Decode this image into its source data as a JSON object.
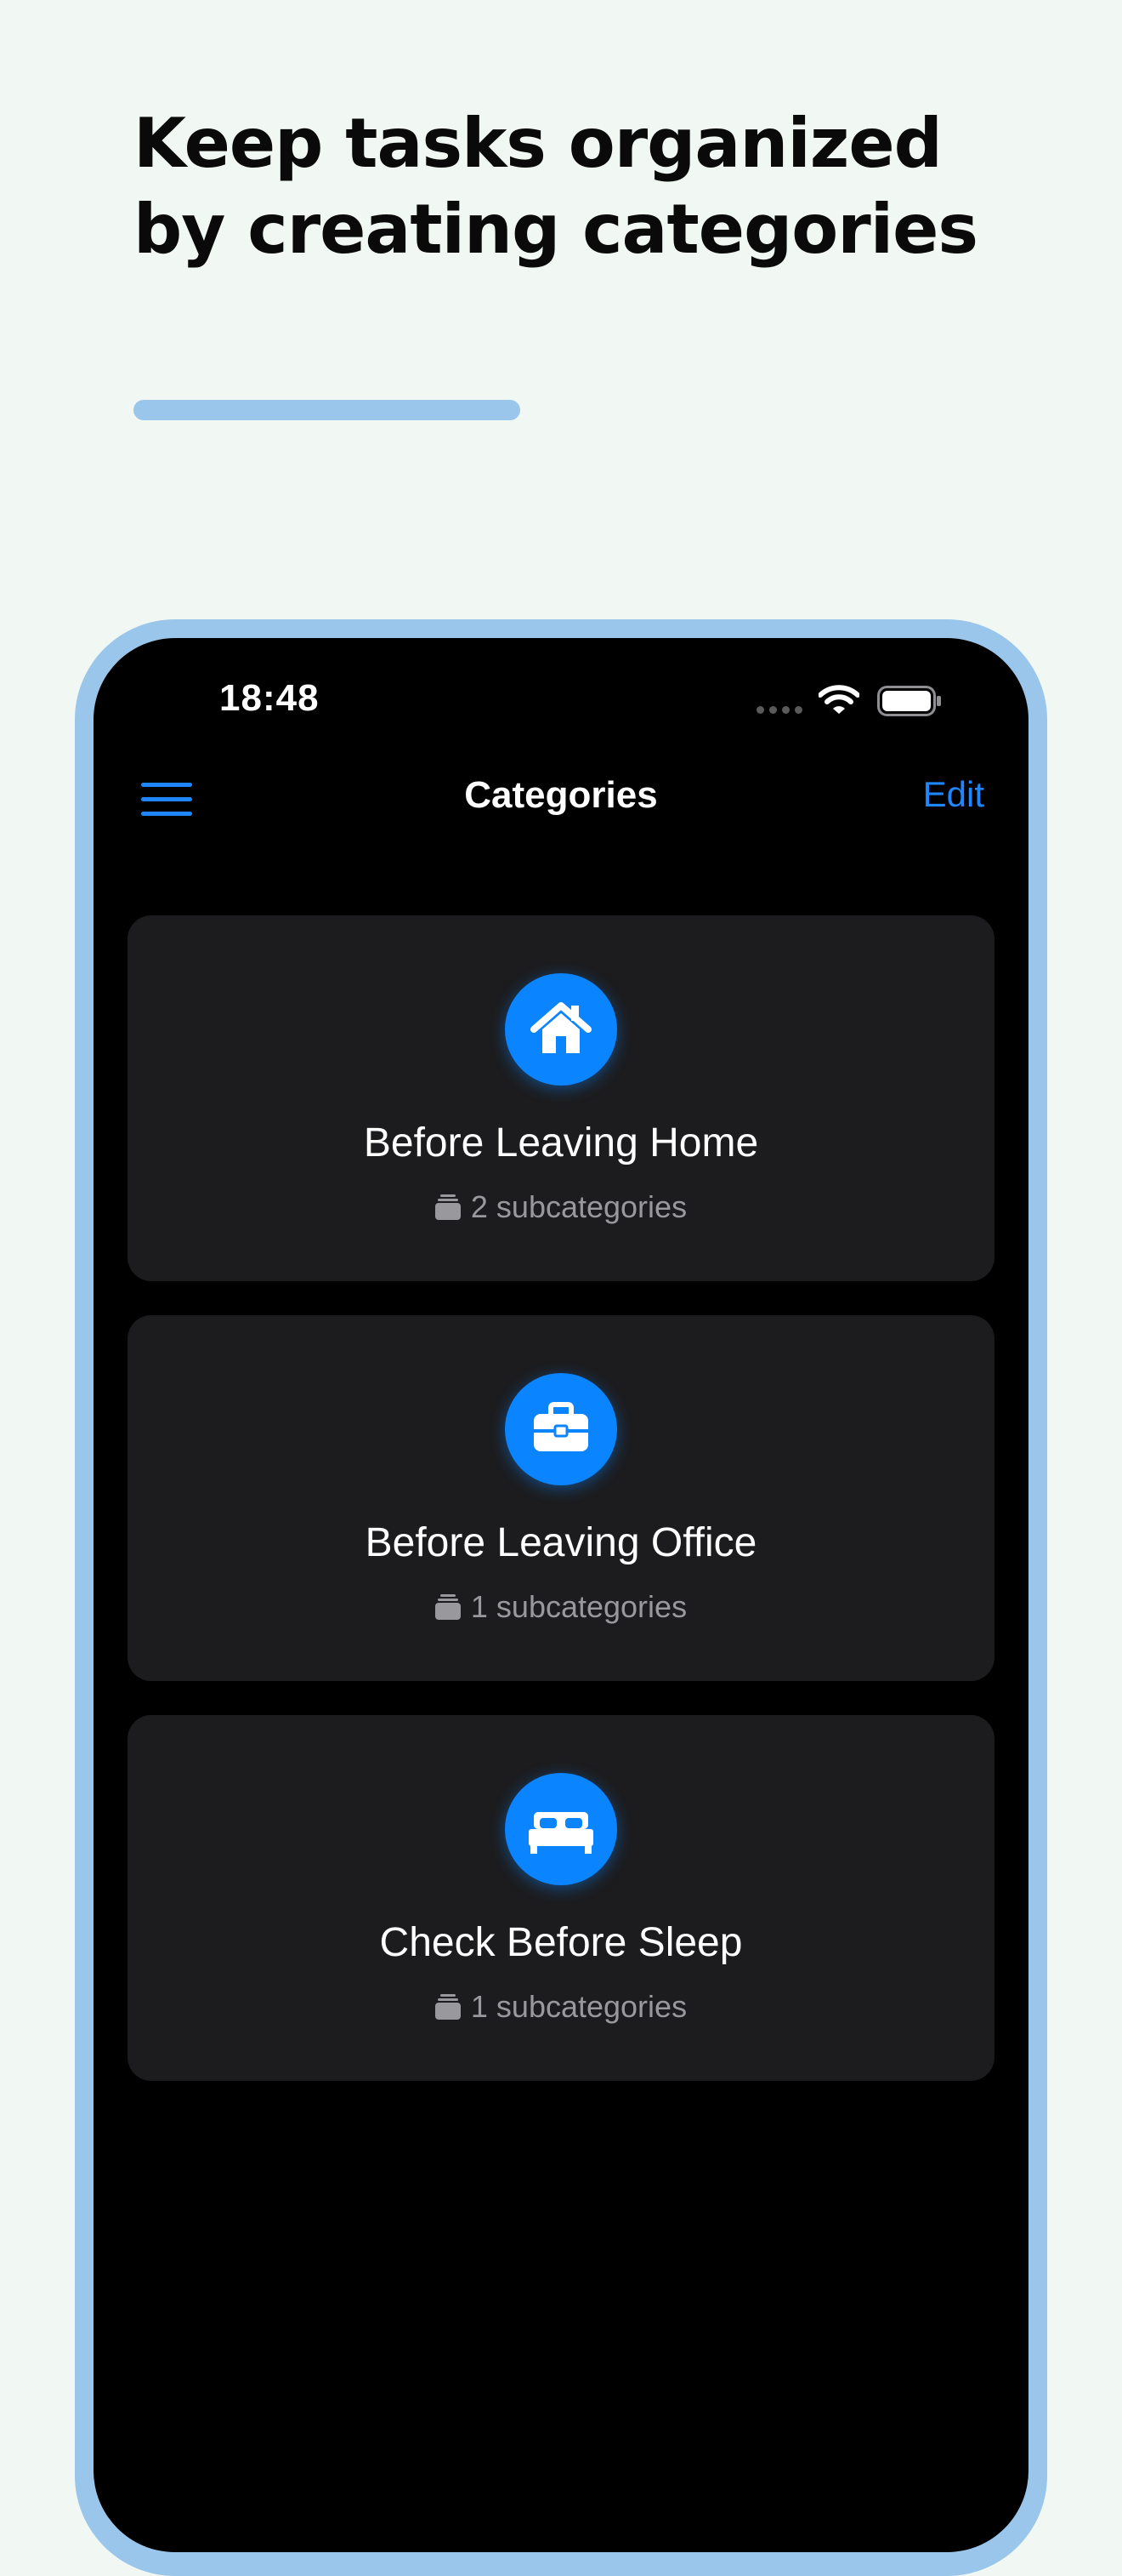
{
  "promo": {
    "headline_line1": "Keep tasks organized",
    "headline_line2": "by creating categories"
  },
  "status_bar": {
    "time": "18:48",
    "icons": [
      "cellular-signal-icon",
      "wifi-icon",
      "battery-icon"
    ]
  },
  "nav": {
    "menu_icon": "hamburger-menu-icon",
    "title": "Categories",
    "edit_label": "Edit"
  },
  "categories": [
    {
      "icon": "house-icon",
      "title": "Before Leaving Home",
      "subtitle": "2 subcategories"
    },
    {
      "icon": "briefcase-icon",
      "title": "Before Leaving Office",
      "subtitle": "1 subcategories"
    },
    {
      "icon": "bed-icon",
      "title": "Check Before Sleep",
      "subtitle": "1 subcategories"
    }
  ],
  "colors": {
    "page_background": "#f1f7f2",
    "frame_accent": "#99c6ea",
    "screen_background": "#000000",
    "card_background": "#1c1c1e",
    "brand_blue": "#0a84ff",
    "secondary_text": "#98989d"
  }
}
